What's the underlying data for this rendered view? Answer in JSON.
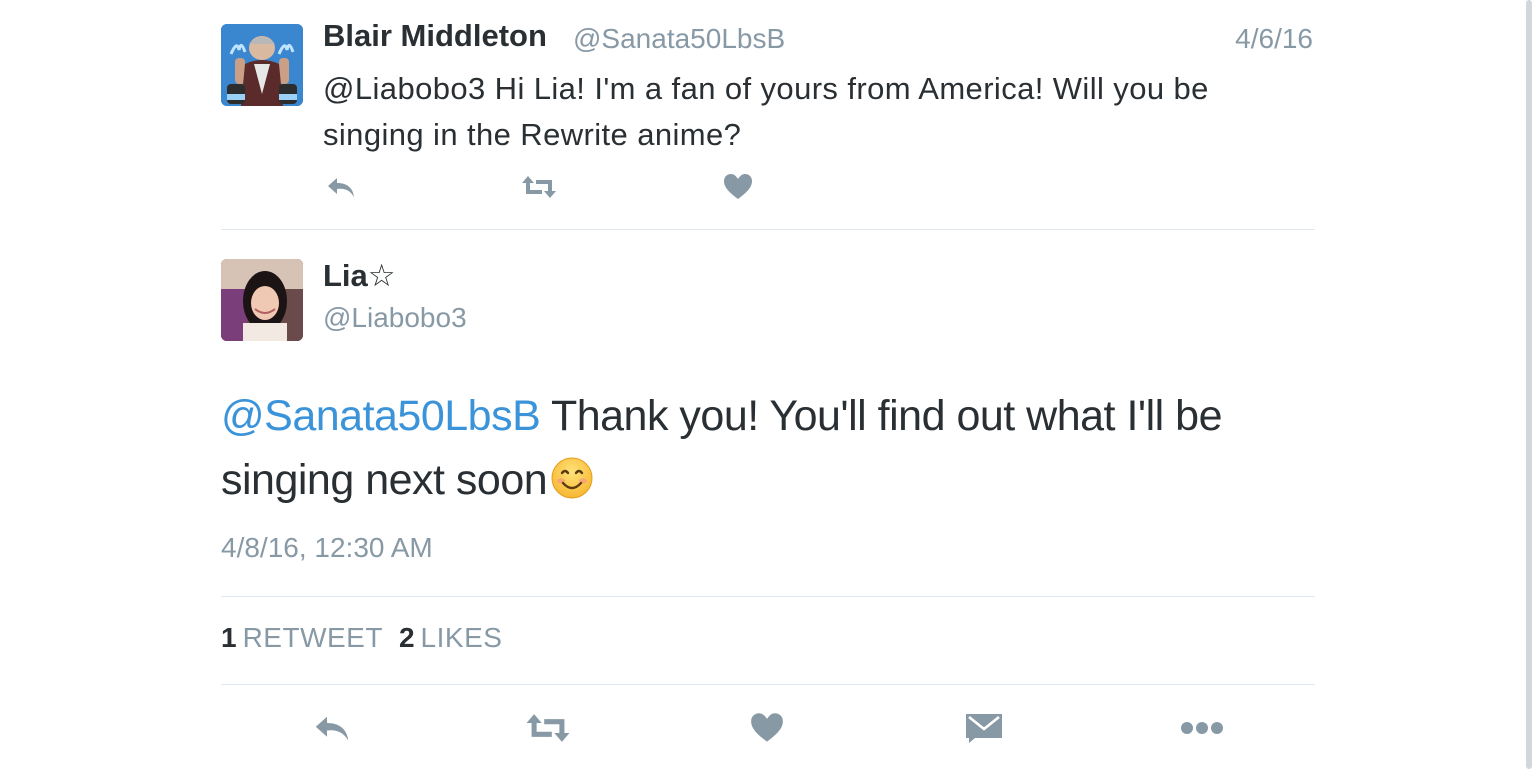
{
  "parent_tweet": {
    "author_name": "Blair Middleton",
    "author_handle": "@Sanata50LbsB",
    "date": "4/6/16",
    "text": "@Liabobo3 Hi Lia! I'm a fan of yours from America! Will you be singing in the Rewrite anime?",
    "actions": [
      "reply-icon",
      "retweet-icon",
      "like-icon"
    ]
  },
  "main_tweet": {
    "author_name": "Lia☆",
    "author_handle": "@Liabobo3",
    "mention": "@Sanata50LbsB",
    "text": " Thank you! You'll find out what I'll be singing next soon",
    "emoji": "smiling-face-emoji",
    "timestamp": "4/8/16, 12:30 AM",
    "retweet_count": "1",
    "retweet_label": "RETWEET",
    "like_count": "2",
    "like_label": "LIKES",
    "actions": [
      "reply-icon",
      "retweet-icon",
      "like-icon",
      "direct-message-icon",
      "more-icon"
    ]
  },
  "colors": {
    "text": "#292f33",
    "secondary": "#8899a6",
    "link": "#3b94d9",
    "icon": "#8899a6",
    "divider": "#e1e8ed"
  }
}
